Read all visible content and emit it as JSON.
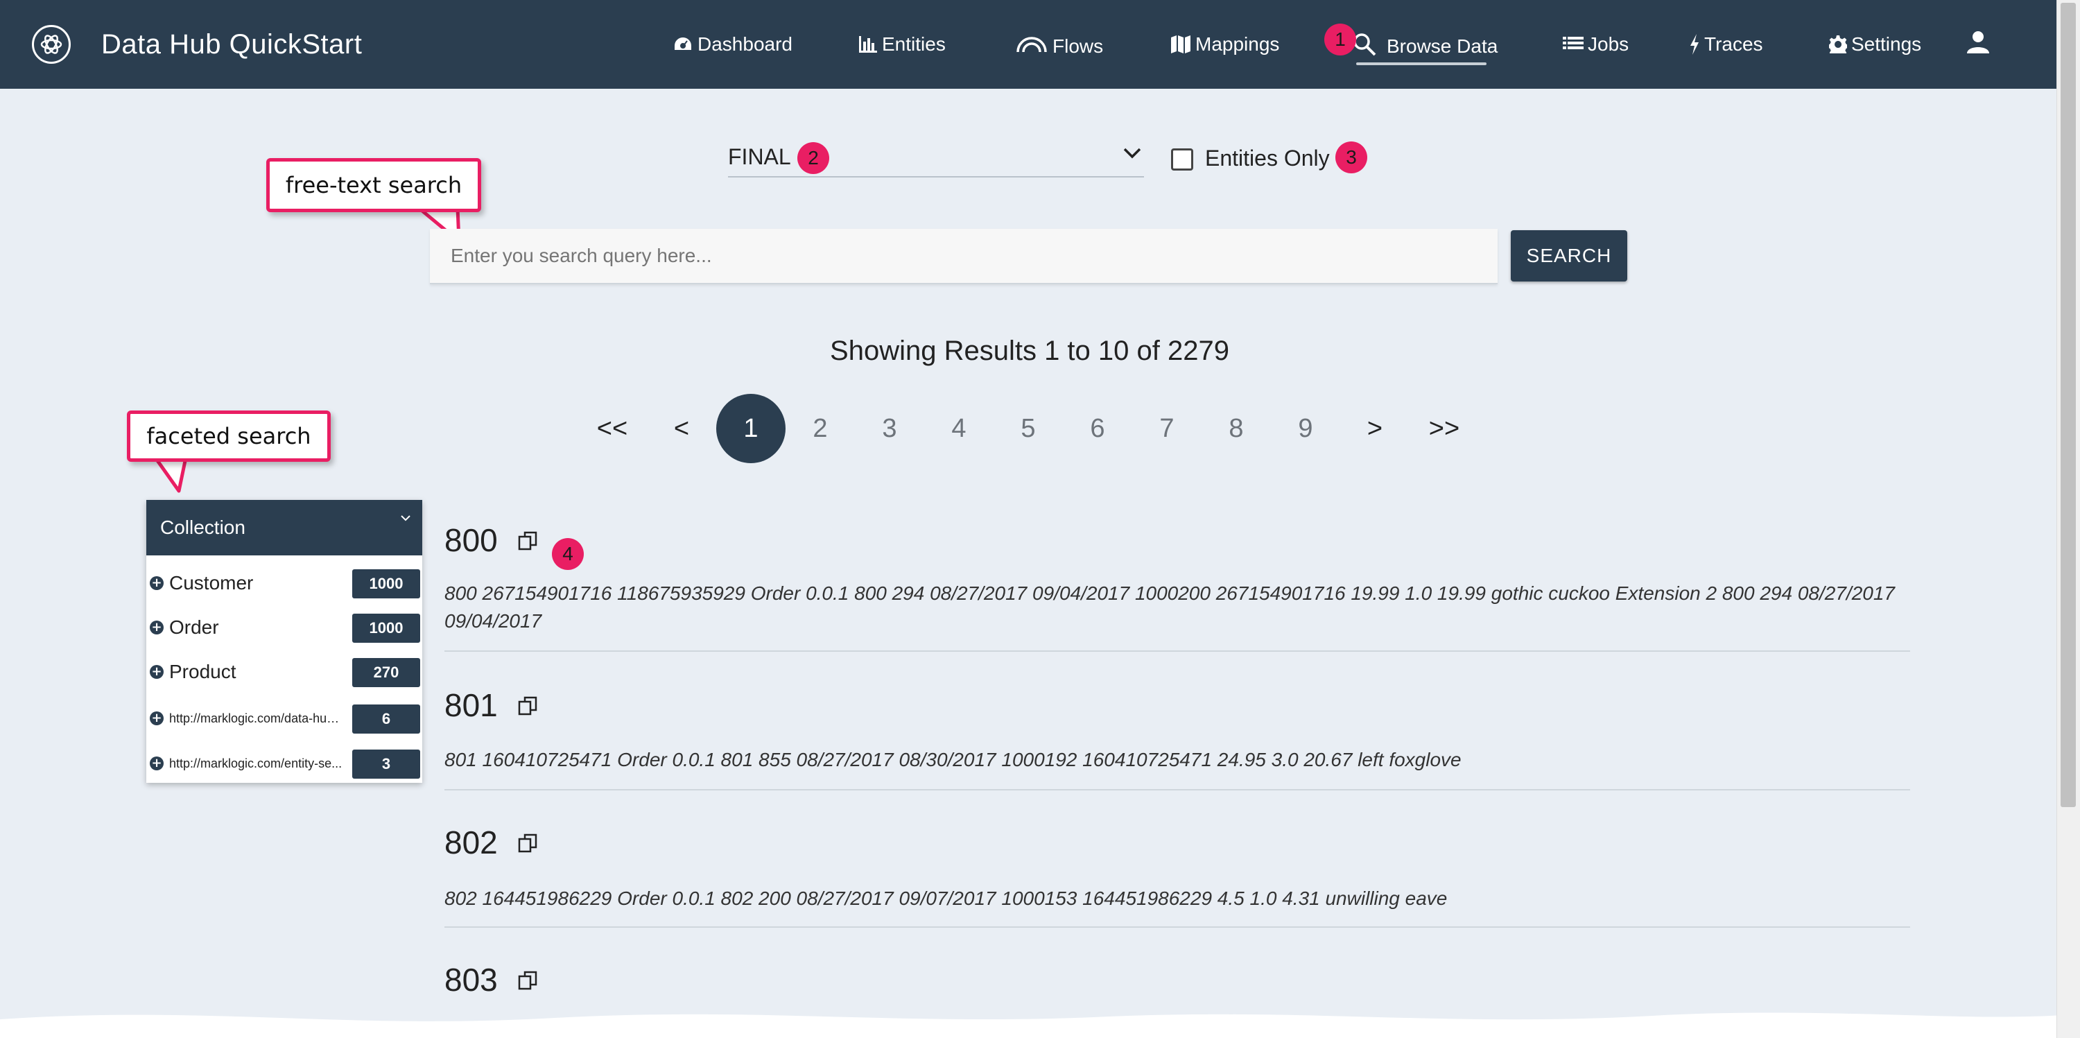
{
  "app": {
    "title": "Data Hub QuickStart",
    "logo_icon": "atom-logo-icon"
  },
  "nav": {
    "items": [
      {
        "label": "Dashboard",
        "icon": "dashboard-gauge-icon"
      },
      {
        "label": "Entities",
        "icon": "bar-chart-icon"
      },
      {
        "label": "Flows",
        "icon": "flows-arc-icon"
      },
      {
        "label": "Mappings",
        "icon": "map-icon"
      },
      {
        "label": "Browse Data",
        "icon": "search-icon",
        "active": true
      },
      {
        "label": "Jobs",
        "icon": "list-icon"
      },
      {
        "label": "Traces",
        "icon": "bolt-icon"
      },
      {
        "label": "Settings",
        "icon": "gear-icon"
      }
    ],
    "user_icon": "user-icon"
  },
  "annotations": {
    "badges": [
      "1",
      "2",
      "3",
      "4"
    ],
    "callout_search": "free-text search",
    "callout_facet": "faceted search",
    "accent_color": "#e91e63"
  },
  "controls": {
    "database": "FINAL",
    "entities_only_label": "Entities Only",
    "entities_only_checked": false
  },
  "search": {
    "placeholder": "Enter you search query here...",
    "value": "",
    "button_label": "SEARCH"
  },
  "results_summary": "Showing Results 1 to 10 of 2279",
  "pagination": {
    "first": "<<",
    "prev": "<",
    "pages": [
      "1",
      "2",
      "3",
      "4",
      "5",
      "6",
      "7",
      "8",
      "9"
    ],
    "current": "1",
    "next": ">",
    "last": ">>"
  },
  "facet": {
    "title": "Collection",
    "items": [
      {
        "name": "Customer",
        "count": "1000"
      },
      {
        "name": "Order",
        "count": "1000"
      },
      {
        "name": "Product",
        "count": "270"
      },
      {
        "name": "http://marklogic.com/data-hub/...",
        "count": "6"
      },
      {
        "name": "http://marklogic.com/entity-se...",
        "count": "3"
      }
    ]
  },
  "results": [
    {
      "id": "800",
      "snippet": "800 267154901716 118675935929 Order 0.0.1 800 294 08/27/2017 09/04/2017 1000200 267154901716 19.99 1.0 19.99 gothic cuckoo Extension 2 800 294 08/27/2017 09/04/2017"
    },
    {
      "id": "801",
      "snippet": "801 160410725471 Order 0.0.1 801 855 08/27/2017 08/30/2017 1000192 160410725471 24.95 3.0 20.67 left foxglove"
    },
    {
      "id": "802",
      "snippet": "802 164451986229 Order 0.0.1 802 200 08/27/2017 09/07/2017 1000153 164451986229 4.5 1.0 4.31 unwilling eave"
    },
    {
      "id": "803",
      "snippet": ""
    }
  ],
  "colors": {
    "primary": "#2b3e50",
    "background": "#e9eef4"
  }
}
